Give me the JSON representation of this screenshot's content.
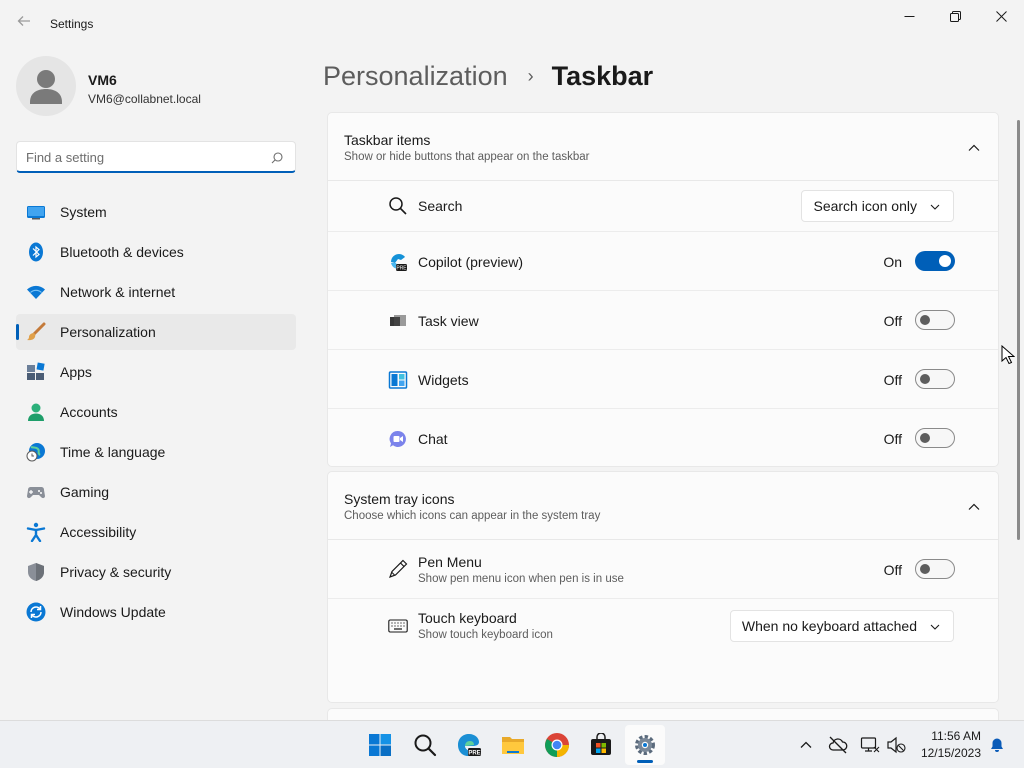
{
  "window": {
    "title": "Settings",
    "controls": [
      "minimize-icon",
      "maximize-icon",
      "close-icon"
    ]
  },
  "user": {
    "name": "VM6",
    "email": "VM6@collabnet.local"
  },
  "search": {
    "placeholder": "Find a setting",
    "value": ""
  },
  "nav": {
    "items": [
      {
        "label": "System",
        "icon": "system-icon"
      },
      {
        "label": "Bluetooth & devices",
        "icon": "bluetooth-icon"
      },
      {
        "label": "Network & internet",
        "icon": "wifi-icon"
      },
      {
        "label": "Personalization",
        "icon": "brush-icon",
        "selected": true
      },
      {
        "label": "Apps",
        "icon": "apps-icon"
      },
      {
        "label": "Accounts",
        "icon": "accounts-icon"
      },
      {
        "label": "Time & language",
        "icon": "globe-clock-icon"
      },
      {
        "label": "Gaming",
        "icon": "gamepad-icon"
      },
      {
        "label": "Accessibility",
        "icon": "accessibility-icon"
      },
      {
        "label": "Privacy & security",
        "icon": "shield-icon"
      },
      {
        "label": "Windows Update",
        "icon": "update-icon"
      }
    ]
  },
  "breadcrumb": {
    "parent": "Personalization",
    "separator": "›",
    "current": "Taskbar"
  },
  "taskbar_items": {
    "title": "Taskbar items",
    "subtitle": "Show or hide buttons that appear on the taskbar",
    "rows": [
      {
        "label": "Search",
        "icon": "search-icon",
        "control": "dropdown",
        "value": "Search icon only"
      },
      {
        "label": "Copilot (preview)",
        "icon": "copilot-icon",
        "control": "toggle",
        "state": "On"
      },
      {
        "label": "Task view",
        "icon": "task-view-icon",
        "control": "toggle",
        "state": "Off"
      },
      {
        "label": "Widgets",
        "icon": "widgets-icon",
        "control": "toggle",
        "state": "Off"
      },
      {
        "label": "Chat",
        "icon": "chat-icon",
        "control": "toggle",
        "state": "Off"
      }
    ]
  },
  "system_tray": {
    "title": "System tray icons",
    "subtitle": "Choose which icons can appear in the system tray",
    "rows": [
      {
        "label": "Pen Menu",
        "sublabel": "Show pen menu icon when pen is in use",
        "icon": "pen-icon",
        "control": "toggle",
        "state": "Off"
      },
      {
        "label": "Touch keyboard",
        "sublabel": "Show touch keyboard icon",
        "icon": "keyboard-icon",
        "control": "dropdown",
        "value": "When no keyboard attached"
      }
    ]
  },
  "taskbar": {
    "apps": [
      "windows-start-icon",
      "taskbar-search-icon",
      "edge-preview-icon",
      "file-explorer-icon",
      "chrome-icon",
      "store-icon",
      "settings-icon"
    ],
    "active_app": "settings-icon",
    "tray": [
      "show-hidden-icons-chevron",
      "onedrive-offline-icon",
      "network-icon",
      "volume-muted-icon"
    ],
    "time": "11:56 AM",
    "date": "12/15/2023",
    "notification_icon": "bell-icon"
  },
  "colors": {
    "accent": "#005fb8",
    "background": "#f3f3f3",
    "card": "#fbfbfb"
  }
}
